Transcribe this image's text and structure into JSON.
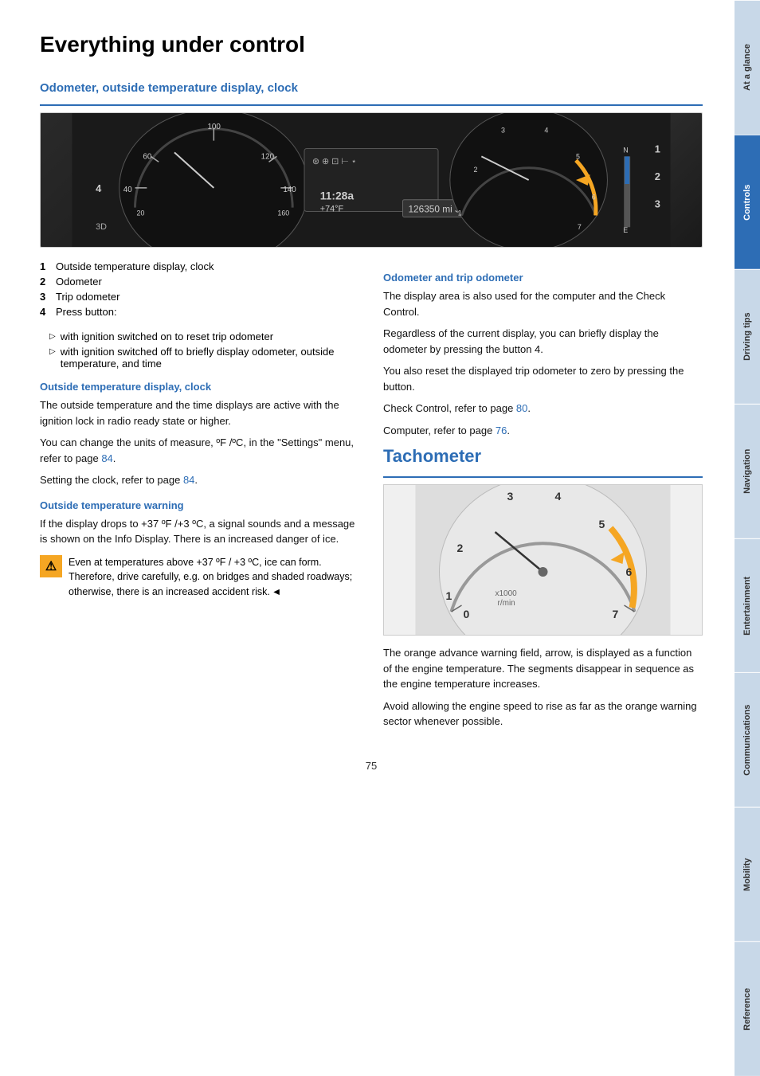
{
  "page": {
    "title": "Everything under control",
    "number": "75"
  },
  "side_tabs": [
    {
      "label": "At a glance",
      "active": false
    },
    {
      "label": "Controls",
      "active": true
    },
    {
      "label": "Driving tips",
      "active": false
    },
    {
      "label": "Navigation",
      "active": false
    },
    {
      "label": "Entertainment",
      "active": false
    },
    {
      "label": "Communications",
      "active": false
    },
    {
      "label": "Mobility",
      "active": false
    },
    {
      "label": "Reference",
      "active": false
    }
  ],
  "section1": {
    "heading": "Odometer, outside temperature display, clock",
    "numbered_items": [
      {
        "num": "1",
        "text": "Outside temperature display, clock"
      },
      {
        "num": "2",
        "text": "Odometer"
      },
      {
        "num": "3",
        "text": "Trip odometer"
      },
      {
        "num": "4",
        "text": "Press button:"
      }
    ],
    "bullet_items": [
      "with ignition switched on to reset trip odometer",
      "with ignition switched off to briefly display odometer, outside temperature, and time"
    ],
    "sub1": {
      "heading": "Outside temperature display, clock",
      "para1": "The outside temperature and the time displays are active with the ignition lock in radio ready state or higher.",
      "para2": "You can change the units of measure, ºF /ºC, in the \"Settings\" menu, refer to page 84.",
      "para3": "Setting the clock, refer to page 84."
    },
    "sub2": {
      "heading": "Outside temperature warning",
      "para1": "If the display drops to +37 ºF /+3 ºC, a signal sounds and a message is shown on the Info Display. There is an increased danger of ice.",
      "warning_text": "Even at temperatures above +37 ºF / +3 ºC, ice can form. Therefore, drive carefully, e.g. on bridges and shaded roadways; otherwise, there is an increased accident risk."
    },
    "sub3": {
      "heading": "Odometer and trip odometer",
      "para1": "The display area is also used for the computer and the Check Control.",
      "para2": "Regardless of the current display, you can briefly display the odometer by pressing the button 4.",
      "para3": "You also reset the displayed trip odometer to zero by pressing the button.",
      "para4": "Check Control, refer to page 80.",
      "para5": "Computer, refer to page 76.",
      "link1": "80",
      "link2": "76"
    }
  },
  "section2": {
    "title": "Tachometer",
    "para1": "The orange advance warning field, arrow, is displayed as a function of the engine temperature. The segments disappear in sequence as the engine temperature increases.",
    "para2": "Avoid allowing the engine speed to rise as far as the orange warning sector whenever possible."
  }
}
